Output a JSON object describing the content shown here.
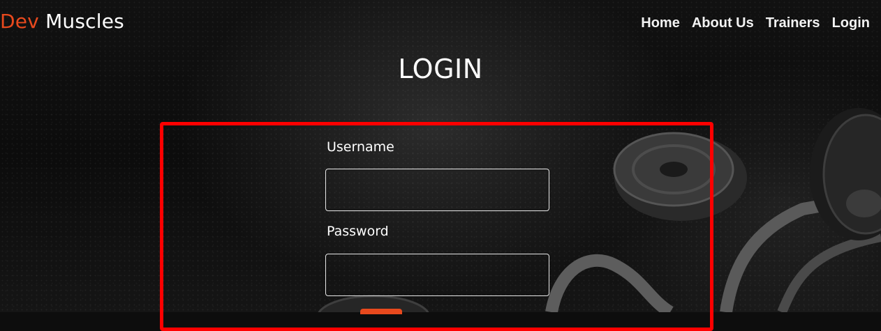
{
  "brand": {
    "accent": "Dev",
    "rest": " Muscles",
    "accent_color": "#e8491d"
  },
  "nav": {
    "items": [
      "Home",
      "About Us",
      "Trainers",
      "Login"
    ]
  },
  "page": {
    "title": "LOGIN"
  },
  "form": {
    "username_label": "Username",
    "username_value": "",
    "password_label": "Password",
    "password_value": "",
    "border_color": "#ff0000"
  },
  "icons": [
    "weight-plate-icon",
    "barbell-icon"
  ]
}
